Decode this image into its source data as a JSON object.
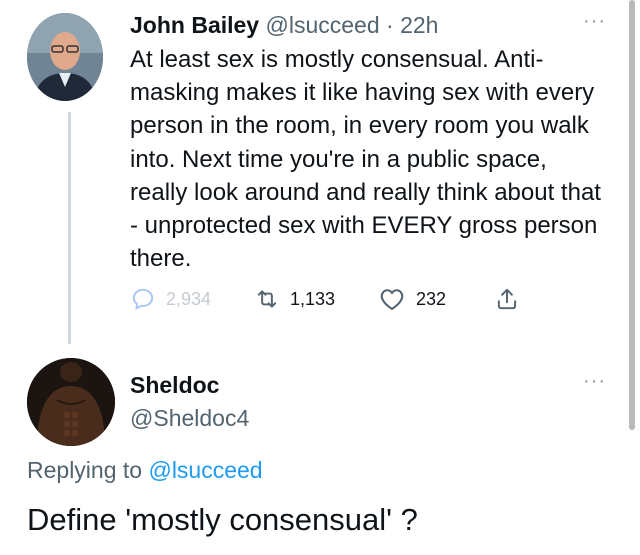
{
  "tweet1": {
    "name": "John Bailey",
    "handle": "@lsucceed",
    "separator": "·",
    "time": "22h",
    "more": "···",
    "body": "At least sex is mostly consensual. Anti-masking makes it like having sex with every person in the room, in every room you walk into. Next time you're in a public space, really look around and really think about that - unprotected sex with EVERY gross person there.",
    "actions": {
      "replies": "2,934",
      "retweets": "1,133",
      "likes": "232"
    },
    "avatar_icon": "profile-photo-icon"
  },
  "tweet2": {
    "name": "Sheldoc",
    "handle": "@Sheldoc4",
    "more": "···",
    "replying_prefix": "Replying to",
    "replying_to": "@lsucceed",
    "body": "Define 'mostly consensual' ?",
    "avatar_icon": "profile-photo-icon"
  },
  "colors": {
    "text": "#0f1419",
    "secondary": "#536471",
    "link": "#1d9bf0",
    "thread_line": "#cfd9de"
  }
}
